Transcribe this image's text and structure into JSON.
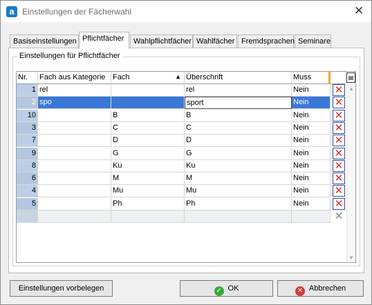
{
  "window": {
    "title": "Einstellungen der Fächerwahl",
    "app_icon": "a"
  },
  "tabs": [
    {
      "label": "Basiseinstellungen",
      "active": false
    },
    {
      "label": "Pflichtfächer",
      "active": true
    },
    {
      "label": "Wahlpflichtfächer",
      "active": false
    },
    {
      "label": "Wahlfächer",
      "active": false
    },
    {
      "label": "Fremdsprachen",
      "active": false
    },
    {
      "label": "Seminare",
      "active": false
    }
  ],
  "group": {
    "legend": "Einstellungen für Pflichtfächer"
  },
  "table": {
    "columns": [
      "Nr.",
      "Fach aus Kategorie",
      "Fach",
      "Überschrift",
      "Muss"
    ],
    "sort_column": "Fach",
    "sort_direction": "ascending",
    "rows": [
      {
        "nr": "1",
        "kategorie": "rel",
        "fach": "",
        "ueberschrift": "rel",
        "muss": "Nein"
      },
      {
        "nr": "2",
        "kategorie": "spo",
        "fach": "",
        "ueberschrift": "sport",
        "muss": "Nein",
        "selected": true
      },
      {
        "nr": "10",
        "kategorie": "",
        "fach": "B",
        "ueberschrift": "B",
        "muss": "Nein"
      },
      {
        "nr": "3",
        "kategorie": "",
        "fach": "C",
        "ueberschrift": "C",
        "muss": "Nein"
      },
      {
        "nr": "7",
        "kategorie": "",
        "fach": "D",
        "ueberschrift": "D",
        "muss": "Nein"
      },
      {
        "nr": "9",
        "kategorie": "",
        "fach": "G",
        "ueberschrift": "G",
        "muss": "Nein"
      },
      {
        "nr": "8",
        "kategorie": "",
        "fach": "Ku",
        "ueberschrift": "Ku",
        "muss": "Nein"
      },
      {
        "nr": "6",
        "kategorie": "",
        "fach": "M",
        "ueberschrift": "M",
        "muss": "Nein"
      },
      {
        "nr": "4",
        "kategorie": "",
        "fach": "Mu",
        "ueberschrift": "Mu",
        "muss": "Nein"
      },
      {
        "nr": "5",
        "kategorie": "",
        "fach": "Ph",
        "ueberschrift": "Ph",
        "muss": "Nein"
      }
    ],
    "delete_icon": "red-x-icon",
    "new_row_delete_icon": "gray-x-icon"
  },
  "buttons": {
    "defaults": "Einstellungen vorbelegen",
    "ok": "OK",
    "cancel": "Abbrechen"
  },
  "colors": {
    "selection": "#3a78d8",
    "row_header": "#bccee5",
    "delete": "#e03030",
    "ok_icon": "#3aa83a",
    "cancel_icon": "#d83a3a"
  }
}
